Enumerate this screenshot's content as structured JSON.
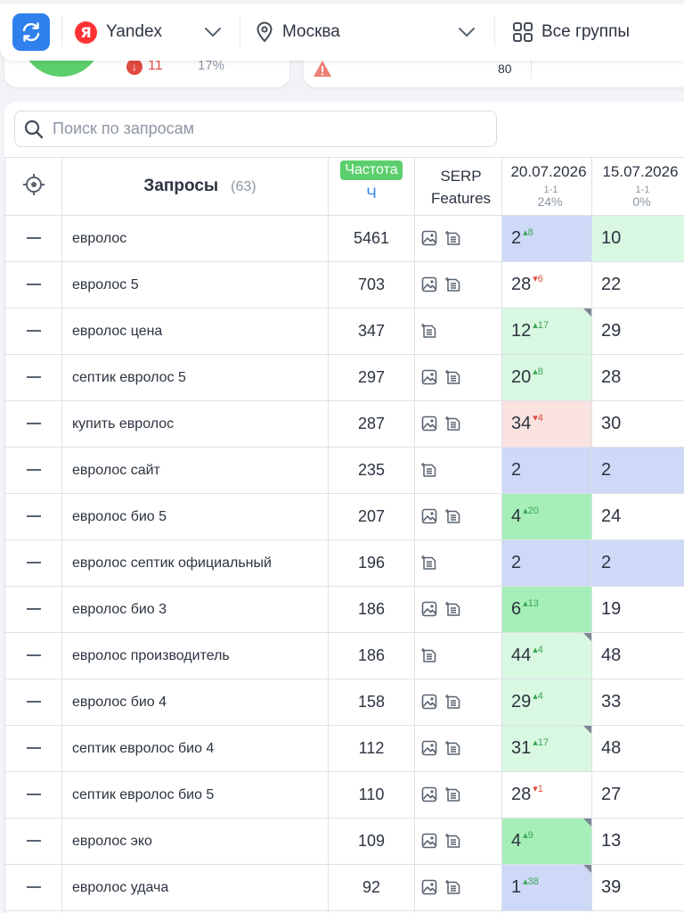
{
  "toolbar": {
    "search_engine": "Yandex",
    "search_engine_logo": "Я",
    "region": "Москва",
    "group": "Все группы"
  },
  "summary": {
    "drop_count": "11",
    "percent": "17%",
    "warning_count": "80"
  },
  "search": {
    "placeholder": "Поиск по запросам"
  },
  "table": {
    "query_header": "Запросы",
    "query_count": "(63)",
    "freq_badge": "Частота",
    "freq_sub": "Ч",
    "serp_header_1": "SERP",
    "serp_header_2": "Features",
    "date1": {
      "date": "20.07.2026",
      "range": "1-1",
      "pct": "24%"
    },
    "date2": {
      "date": "15.07.2026",
      "range": "1-1",
      "pct": "0%"
    },
    "rows": [
      {
        "query": "евролос",
        "freq": "5461",
        "img": true,
        "p1": "2",
        "d1": "8",
        "dir": "up",
        "c1": "blue",
        "corner": false,
        "p2": "10",
        "c2": "lgreen"
      },
      {
        "query": "евролос 5",
        "freq": "703",
        "img": true,
        "p1": "28",
        "d1": "6",
        "dir": "down",
        "c1": "white",
        "corner": false,
        "p2": "22",
        "c2": "white"
      },
      {
        "query": "евролос цена",
        "freq": "347",
        "img": false,
        "p1": "12",
        "d1": "17",
        "dir": "up",
        "c1": "lgreen",
        "corner": true,
        "p2": "29",
        "c2": "white"
      },
      {
        "query": "септик евролос 5",
        "freq": "297",
        "img": true,
        "p1": "20",
        "d1": "8",
        "dir": "up",
        "c1": "lgreen",
        "corner": false,
        "p2": "28",
        "c2": "white"
      },
      {
        "query": "купить евролос",
        "freq": "287",
        "img": true,
        "p1": "34",
        "d1": "4",
        "dir": "down",
        "c1": "red",
        "corner": false,
        "p2": "30",
        "c2": "white"
      },
      {
        "query": "евролос сайт",
        "freq": "235",
        "img": false,
        "p1": "2",
        "d1": "",
        "dir": "",
        "c1": "blue",
        "corner": false,
        "p2": "2",
        "c2": "blue"
      },
      {
        "query": "евролос био 5",
        "freq": "207",
        "img": true,
        "p1": "4",
        "d1": "20",
        "dir": "up",
        "c1": "green",
        "corner": false,
        "p2": "24",
        "c2": "white"
      },
      {
        "query": "евролос септик официальный",
        "freq": "196",
        "img": false,
        "p1": "2",
        "d1": "",
        "dir": "",
        "c1": "blue",
        "corner": false,
        "p2": "2",
        "c2": "blue"
      },
      {
        "query": "евролос био 3",
        "freq": "186",
        "img": true,
        "p1": "6",
        "d1": "13",
        "dir": "up",
        "c1": "green",
        "corner": false,
        "p2": "19",
        "c2": "white"
      },
      {
        "query": "евролос производитель",
        "freq": "186",
        "img": false,
        "p1": "44",
        "d1": "4",
        "dir": "up",
        "c1": "lgreen",
        "corner": true,
        "p2": "48",
        "c2": "white"
      },
      {
        "query": "евролос био 4",
        "freq": "158",
        "img": true,
        "p1": "29",
        "d1": "4",
        "dir": "up",
        "c1": "lgreen",
        "corner": false,
        "p2": "33",
        "c2": "white"
      },
      {
        "query": "септик евролос био 4",
        "freq": "112",
        "img": true,
        "p1": "31",
        "d1": "17",
        "dir": "up",
        "c1": "lgreen",
        "corner": true,
        "p2": "48",
        "c2": "white"
      },
      {
        "query": "септик евролос био 5",
        "freq": "110",
        "img": true,
        "p1": "28",
        "d1": "1",
        "dir": "down",
        "c1": "white",
        "corner": false,
        "p2": "27",
        "c2": "white"
      },
      {
        "query": "евролос эко",
        "freq": "109",
        "img": true,
        "p1": "4",
        "d1": "9",
        "dir": "up",
        "c1": "green",
        "corner": true,
        "p2": "13",
        "c2": "white"
      },
      {
        "query": "евролос удача",
        "freq": "92",
        "img": true,
        "p1": "1",
        "d1": "38",
        "dir": "up",
        "c1": "blue",
        "corner": true,
        "p2": "39",
        "c2": "white"
      },
      {
        "query": "",
        "freq": "",
        "img": false,
        "p1": "",
        "d1": "",
        "dir": "",
        "c1": "white",
        "corner": false,
        "p2": "",
        "c2": "white"
      }
    ]
  }
}
